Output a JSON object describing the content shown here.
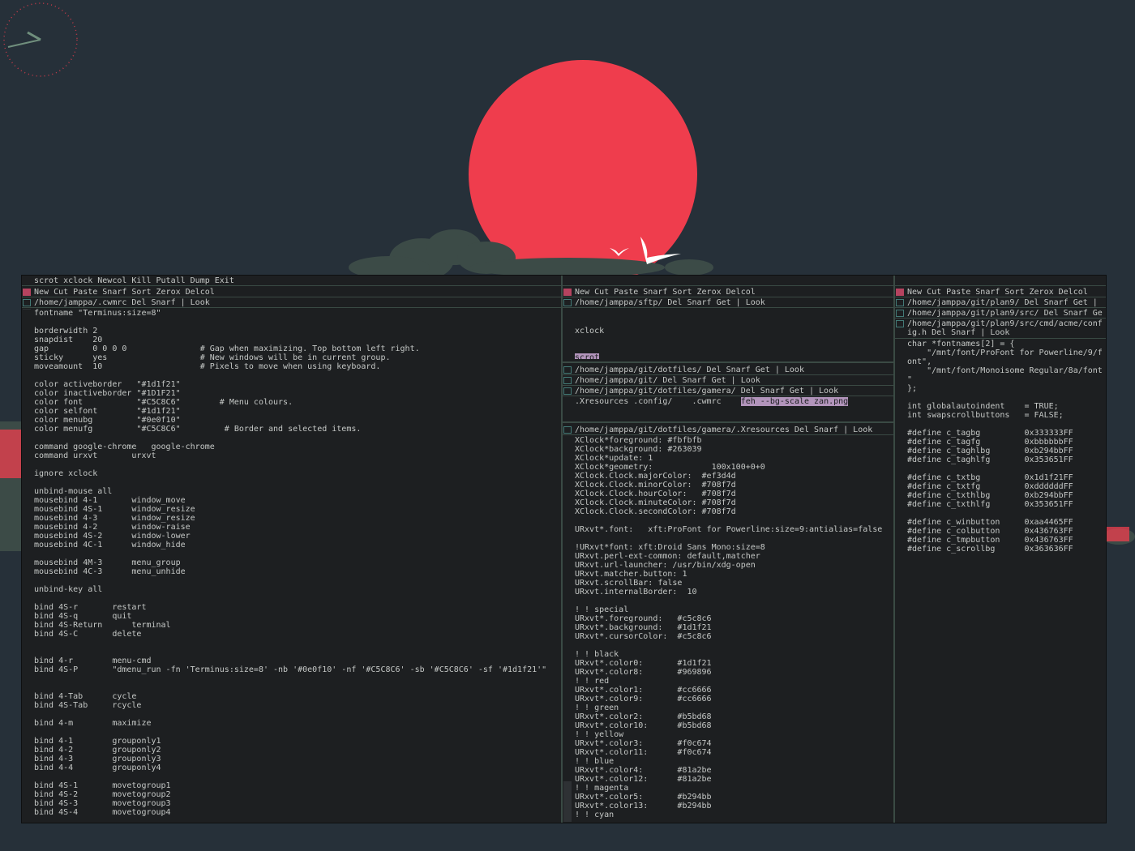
{
  "colors": {
    "desktop": "#263039",
    "sun": "#ef3d4d",
    "clouds": "#3c4b47",
    "window_bg": "#1d1f21",
    "text": "#c5c8c6",
    "highlight": "#b294bb",
    "tag_box_dirty": "#b5435f",
    "tag_box_clean": "#437a76"
  },
  "main_tag": "scrot xclock Newcol Kill Putall Dump Exit",
  "col1": {
    "tag": "New Cut Paste Snarf Sort Zerox Delcol",
    "win_tag": "/home/jamppa/.cwmrc Del Snarf | Look",
    "body": "fontname \"Terminus:size=8\"\n\nborderwidth 2\nsnapdist    20\ngap         0 0 0 0               # Gap when maximizing. Top bottom left right.\nsticky      yes                   # New windows will be in current group.\nmoveamount  10                    # Pixels to move when using keyboard.\n\ncolor activeborder   \"#1d1f21\"\ncolor inactiveborder \"#1D1F21\"\ncolor font           \"#C5C8C6\"        # Menu colours.\ncolor selfont        \"#1d1f21\"\ncolor menubg         \"#0e0f10\"\ncolor menufg         \"#C5C8C6\"         # Border and selected items.\n\ncommand google-chrome   google-chrome\ncommand urxvt       urxvt\n\nignore xclock\n\nunbind-mouse all\nmousebind 4-1       window_move\nmousebind 4S-1      window_resize\nmousebind 4-3       window_resize\nmousebind 4-2       window-raise\nmousebind 4S-2      window-lower\nmousebind 4C-1      window_hide\n\nmousebind 4M-3      menu_group\nmousebind 4C-3      menu_unhide\n\nunbind-key all\n\nbind 4S-r       restart\nbind 4S-q       quit\nbind 4S-Return      terminal\nbind 4S-C       delete\n\n\nbind 4-r        menu-cmd\nbind 4S-P       \"dmenu_run -fn 'Terminus:size=8' -nb '#0e0f10' -nf '#C5C8C6' -sb '#C5C8C6' -sf '#1d1f21'\"\n\n\nbind 4-Tab      cycle\nbind 4S-Tab     rcycle\n\nbind 4-m        maximize\n\nbind 4-1        grouponly1\nbind 4-2        grouponly2\nbind 4-3        grouponly3\nbind 4-4        grouponly4\n\nbind 4S-1       movetogroup1\nbind 4S-2       movetogroup2\nbind 4S-3       movetogroup3\nbind 4S-4       movetogroup4"
  },
  "col2": {
    "tag": "New Cut Paste Snarf Sort Zerox Delcol",
    "w1_tag": "/home/jamppa/sftp/ Del Snarf Get | Look",
    "w1_line1": "xclock",
    "w1_line2": "scrot",
    "w2_tag": "/home/jamppa/git/dotfiles/ Del Snarf Get | Look",
    "w3_tag": "/home/jamppa/git/ Del Snarf Get | Look",
    "w4_tag": "/home/jamppa/git/dotfiles/gamera/ Del Snarf Get | Look",
    "w4_body": ".Xresources .config/    .cwmrc",
    "w4_cmd": "feh --bg-scale zan.png",
    "w5_tag": "/home/jamppa/git/dotfiles/gamera/.Xresources Del Snarf | Look",
    "w5_body": "XClock*foreground: #fbfbfb\nXClock*background: #263039\nXClock*update: 1\nXClock*geometry:            100x100+0+0\nXClock.Clock.majorColor:  #ef3d4d\nXClock.Clock.minorColor:  #708f7d\nXClock.Clock.hourColor:   #708f7d\nXClock.Clock.minuteColor: #708f7d\nXClock.Clock.secondColor: #708f7d\n\nURxvt*.font:   xft:ProFont for Powerline:size=9:antialias=false\n\n!URxvt*font: xft:Droid Sans Mono:size=8\nURxvt.perl-ext-common: default,matcher\nURxvt.url-launcher: /usr/bin/xdg-open\nURxvt.matcher.button: 1\nURxvt.scrollBar: false\nURxvt.internalBorder:  10\n\n! ! special\nURxvt*.foreground:   #c5c8c6\nURxvt*.background:   #1d1f21\nURxvt*.cursorColor:  #c5c8c6\n\n! ! black\nURxvt*.color0:       #1d1f21\nURxvt*.color8:       #969896\n! ! red\nURxvt*.color1:       #cc6666\nURxvt*.color9:       #cc6666\n! ! green\nURxvt*.color2:       #b5bd68\nURxvt*.color10:      #b5bd68\n! ! yellow\nURxvt*.color3:       #f0c674\nURxvt*.color11:      #f0c674\n! ! blue\nURxvt*.color4:       #81a2be\nURxvt*.color12:      #81a2be\n! ! magenta\nURxvt*.color5:       #b294bb\nURxvt*.color13:      #b294bb\n! ! cyan"
  },
  "col3": {
    "tag": "New Cut Paste Snarf Sort Zerox Delcol",
    "w1_tag": "/home/jamppa/git/plan9/ Del Snarf Get |",
    "w2_tag": "/home/jamppa/git/plan9/src/ Del Snarf Ge",
    "w3_tag": "/home/jamppa/git/plan9/src/cmd/acme/conf\nig.h Del Snarf | Look",
    "w3_body": "char *fontnames[2] = {\n    \"/mnt/font/ProFont for Powerline/9/f\nont\",\n    \"/mnt/font/Monoisome Regular/8a/font\n\"\n};\n\nint globalautoindent    = TRUE;\nint swapscrollbuttons   = FALSE;\n\n#define c_tagbg         0x333333FF\n#define c_tagfg         0xbbbbbbFF\n#define c_taghlbg       0xb294bbFF\n#define c_taghlfg       0x353651FF\n\n#define c_txtbg         0x1d1f21FF\n#define c_txtfg         0xddddddFF\n#define c_txthlbg       0xb294bbFF\n#define c_txthlfg       0x353651FF\n\n#define c_winbutton     0xaa4465FF\n#define c_colbutton     0x436763FF\n#define c_tmpbutton     0x436763FF\n#define c_scrollbg      0x363636FF"
  }
}
